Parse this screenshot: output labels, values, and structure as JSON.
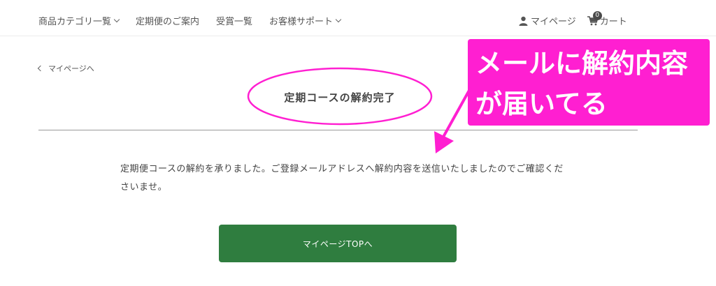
{
  "nav": {
    "left": [
      {
        "label": "商品カテゴリ一覧",
        "dropdown": true
      },
      {
        "label": "定期便のご案内",
        "dropdown": false
      },
      {
        "label": "受賞一覧",
        "dropdown": false
      },
      {
        "label": "お客様サポート",
        "dropdown": true
      }
    ],
    "mypage_label": "マイページ",
    "cart_label": "カート",
    "cart_count": "0",
    "icons": [
      "person-icon",
      "cart-icon",
      "chevron-down-icon"
    ]
  },
  "back_link": {
    "label": "マイページへ",
    "icon": "chevron-left-icon"
  },
  "page": {
    "title": "定期コースの解約完了",
    "message": "定期便コースの解約を承りました。ご登録メールアドレスへ解約内容を送信いたしましたのでご確認くださいませ。",
    "button_label": "マイページTOPへ"
  },
  "annotation": {
    "line1": "メールに解約内容",
    "line2": "が届いてる",
    "color": "#ff1fd1"
  },
  "colors": {
    "button": "#2f7d3f",
    "text": "#444444",
    "highlight": "#ff1fd1"
  }
}
